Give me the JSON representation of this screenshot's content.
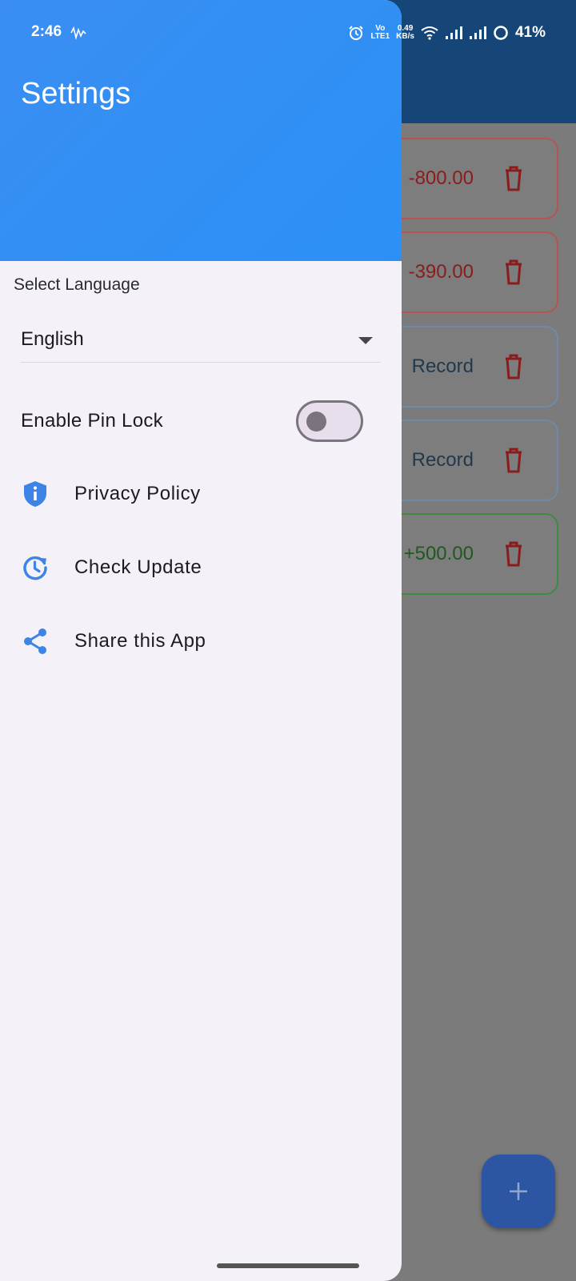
{
  "status_bar": {
    "time": "2:46",
    "volte_top": "Vo",
    "volte_bottom": "LTE1",
    "speed_top": "0.49",
    "speed_bottom": "KB/s",
    "battery": "41%"
  },
  "drawer": {
    "title": "Settings",
    "language": {
      "label": "Select Language",
      "selected": "English"
    },
    "pin_lock": {
      "label": "Enable Pin Lock",
      "enabled": false
    },
    "menu": [
      {
        "label": "Privacy Policy",
        "icon": "shield-info-icon"
      },
      {
        "label": "Check Update",
        "icon": "update-clock-icon"
      },
      {
        "label": "Share this App",
        "icon": "share-icon"
      }
    ]
  },
  "background_records": [
    {
      "text": "-800.00",
      "kind": "expense"
    },
    {
      "text": "-390.00",
      "kind": "expense"
    },
    {
      "text": "Record",
      "kind": "neutral"
    },
    {
      "text": "Record",
      "kind": "neutral"
    },
    {
      "text": "+500.00",
      "kind": "income"
    }
  ],
  "colors": {
    "header_blue": "#2b90f6",
    "icon_blue": "#3d84e6",
    "expense_red": "#c62828",
    "income_green": "#2e7d32"
  },
  "fab": {
    "icon": "plus-icon"
  }
}
